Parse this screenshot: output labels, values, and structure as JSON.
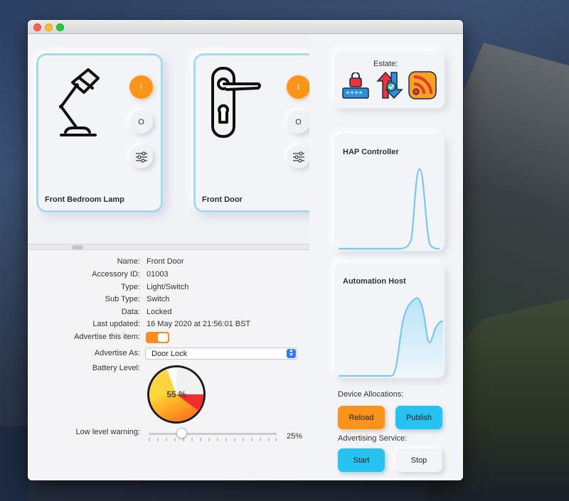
{
  "devices": [
    {
      "name": "Front Bedroom Lamp",
      "on_label": "I",
      "off_label": "O"
    },
    {
      "name": "Front Door",
      "on_label": "I",
      "off_label": "O"
    }
  ],
  "details": {
    "labels": {
      "name": "Name:",
      "accessory_id": "Accessory ID:",
      "type": "Type:",
      "sub_type": "Sub Type:",
      "data": "Data:",
      "last_updated": "Last updated:",
      "advertise_item": "Advertise this item:",
      "advertise_as": "Advertise As:",
      "battery_level": "Battery Level:",
      "low_level_warning": "Low level warning:"
    },
    "values": {
      "name": "Front Door",
      "accessory_id": "01003",
      "type": "Light/Switch",
      "sub_type": "Switch",
      "data": "Locked",
      "last_updated": "16 May 2020 at 21:56:01 BST",
      "advertise_item": true,
      "advertise_as": "Door Lock",
      "battery_text": "55 %",
      "battery_fraction": 0.55,
      "low_level_warning": "25%",
      "low_level_fraction": 0.25
    }
  },
  "right_panel": {
    "estate_label": "Estate:",
    "hap_title": "HAP Controller",
    "automation_title": "Automation Host",
    "device_allocations_label": "Device Allocations:",
    "reload_label": "Reload",
    "publish_label": "Publish",
    "advertising_service_label": "Advertising Service:",
    "start_label": "Start",
    "stop_label": "Stop"
  },
  "colors": {
    "accent_orange": "#f99319",
    "accent_blue": "#27c3f0",
    "card_border": "#a6dbee",
    "graph_line": "#79c8f0"
  },
  "icons": [
    "lamp-icon",
    "door-handle-icon",
    "sliders-icon",
    "password-lock-icon",
    "sync-arrows-icon",
    "rss-feed-icon"
  ]
}
